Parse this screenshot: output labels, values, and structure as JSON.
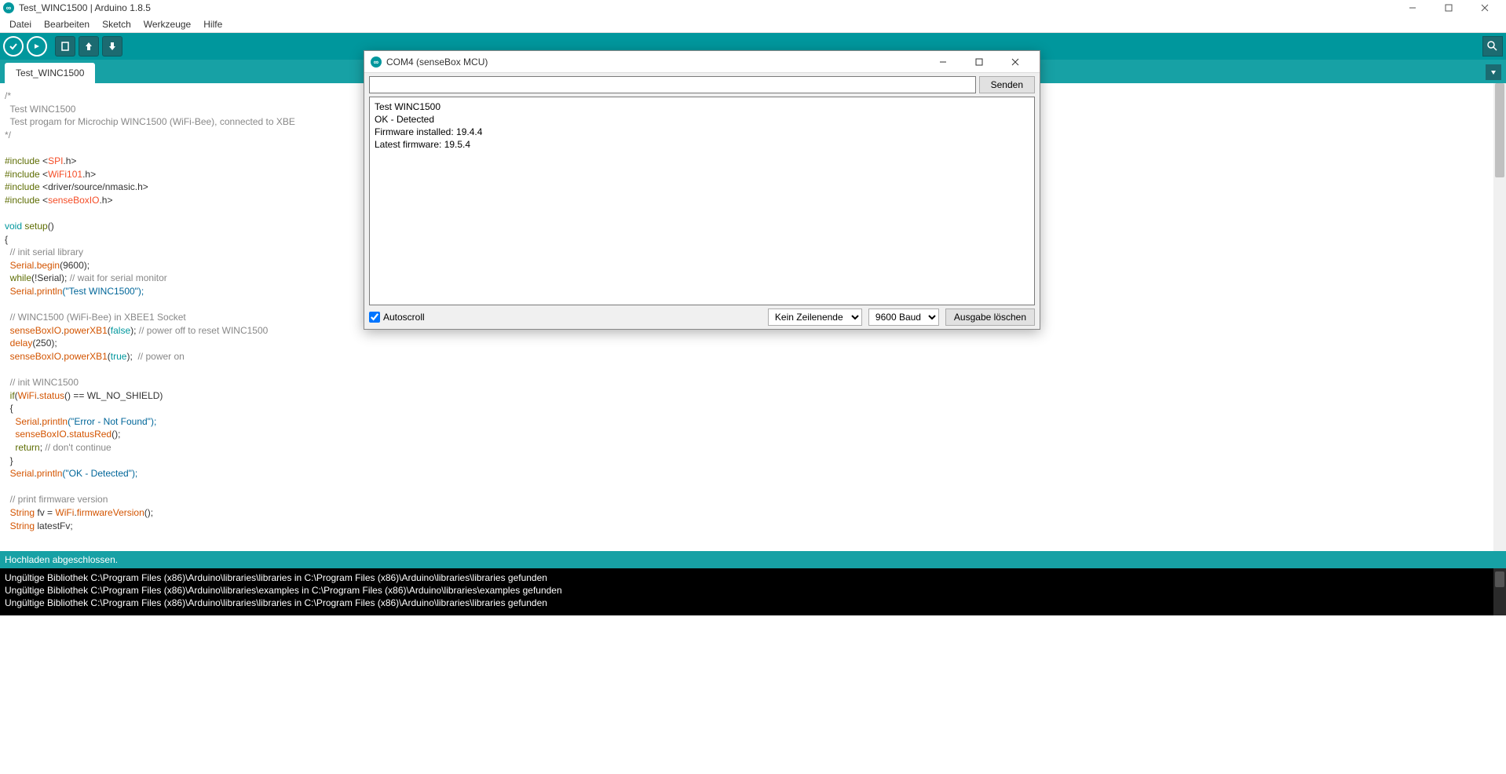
{
  "window": {
    "title": "Test_WINC1500 | Arduino 1.8.5"
  },
  "menu": {
    "file": "Datei",
    "edit": "Bearbeiten",
    "sketch": "Sketch",
    "tools": "Werkzeuge",
    "help": "Hilfe"
  },
  "tab": {
    "name": "Test_WINC1500"
  },
  "code": {
    "l1": "/*",
    "l2": "  Test WINC1500",
    "l3": "",
    "l4": "  Test progam for Microchip WINC1500 (WiFi-Bee), connected to XBE",
    "l5": "*/",
    "l6": "",
    "inc": "#include ",
    "spi": "SPI",
    "wifi101": "WiFi101",
    "nmasic": "driver/source/nmasic.h",
    "sensebox": "senseBoxIO",
    "dot_h": ".h",
    "lt": "<",
    "gt": ">",
    "void": "void",
    "setup": " setup",
    "parens": "()",
    "brace_open": "{",
    "brace_close": "}",
    "cmt_init_serial": "  // init serial library",
    "serial": "Serial",
    "begin": "begin",
    "baud": "(9600);",
    "while_serial": "(!Serial);",
    "cmt_wait": " // wait for serial monitor",
    "println": "println",
    "test_str": "(\"Test WINC1500\");",
    "cmt_winc": "  // WINC1500 (WiFi-Bee) in XBEE1 Socket",
    "senseboxio": "senseBoxIO",
    "powerxb1": "powerXB1",
    "false_arg": "(",
    "false_val": "false",
    "false_end": ");",
    "cmt_poweroff": " // power off to reset WINC1500",
    "delay": "delay",
    "delay_arg": "(250);",
    "true_val": "true",
    "cmt_poweron": "  // power on",
    "cmt_initwinc": "  // init WINC1500",
    "if": "if",
    "wifi": "WiFi",
    "status": "status",
    "eq_noshield": "() == WL_NO_SHIELD)",
    "err_str": "(\"Error - Not Found\");",
    "statusred": "statusRed",
    "empty_call": "();",
    "return": "return",
    "semi": ";",
    "cmt_dont": " // don't continue",
    "ok_str": "(\"OK - Detected\");",
    "cmt_fw": "  // print firmware version",
    "string_t": "String",
    "fv_decl": " fv = ",
    "firmwarever": "firmwareVersion",
    "fv_end": "();",
    "latest_decl": " latestFv;",
    "while": "while",
    "dot": "."
  },
  "status": {
    "text": "Hochladen abgeschlossen."
  },
  "console": {
    "l1": "Ungültige Bibliothek C:\\Program Files (x86)\\Arduino\\libraries\\libraries in C:\\Program Files (x86)\\Arduino\\libraries\\libraries gefunden",
    "l2": "Ungültige Bibliothek C:\\Program Files (x86)\\Arduino\\libraries\\examples in C:\\Program Files (x86)\\Arduino\\libraries\\examples gefunden",
    "l3": "Ungültige Bibliothek C:\\Program Files (x86)\\Arduino\\libraries\\libraries in C:\\Program Files (x86)\\Arduino\\libraries\\libraries gefunden"
  },
  "serial": {
    "title": "COM4 (senseBox MCU)",
    "send": "Senden",
    "out_l1": "Test WINC1500",
    "out_l2": "OK - Detected",
    "out_l3": "Firmware installed: 19.4.4",
    "out_l4": "Latest firmware: 19.5.4",
    "autoscroll": "Autoscroll",
    "line_ending": "Kein Zeilenende",
    "baud": "9600 Baud",
    "clear": "Ausgabe löschen"
  }
}
